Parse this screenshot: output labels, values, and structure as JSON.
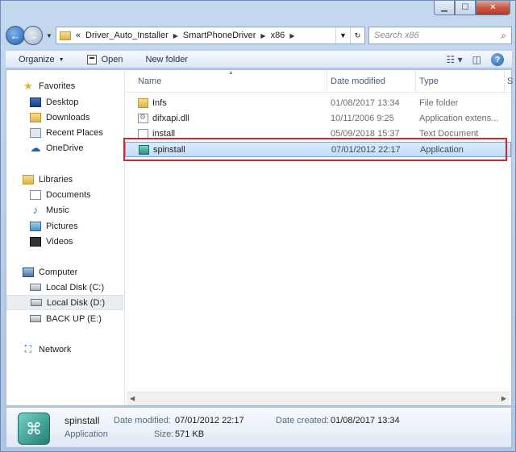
{
  "window": {
    "controls": {
      "minimize": "▁",
      "maximize": "☐",
      "close": "✕"
    }
  },
  "address": {
    "overflow": "«",
    "parts": [
      "Driver_Auto_Installer",
      "SmartPhoneDriver",
      "x86"
    ],
    "search_placeholder": "Search x86"
  },
  "toolbar": {
    "organize": "Organize",
    "open": "Open",
    "new_folder": "New folder"
  },
  "nav": {
    "favorites": "Favorites",
    "desktop": "Desktop",
    "downloads": "Downloads",
    "recent": "Recent Places",
    "onedrive": "OneDrive",
    "libraries": "Libraries",
    "documents": "Documents",
    "music": "Music",
    "pictures": "Pictures",
    "videos": "Videos",
    "computer": "Computer",
    "disk_c": "Local Disk (C:)",
    "disk_d": "Local Disk (D:)",
    "backup_e": "BACK UP (E:)",
    "network": "Network"
  },
  "columns": {
    "name": "Name",
    "date": "Date modified",
    "type": "Type",
    "size": "S"
  },
  "files": [
    {
      "name": "Infs",
      "date": "01/08/2017 13:34",
      "type": "File folder"
    },
    {
      "name": "difxapi.dll",
      "date": "10/11/2006 9:25",
      "type": "Application extens..."
    },
    {
      "name": "install",
      "date": "05/09/2018 15:37",
      "type": "Text Document"
    },
    {
      "name": "spinstall",
      "date": "07/01/2012 22:17",
      "type": "Application"
    }
  ],
  "details": {
    "name": "spinstall",
    "kind": "Application",
    "modified_label": "Date modified:",
    "modified_value": "07/01/2012 22:17",
    "created_label": "Date created:",
    "created_value": "01/08/2017 13:34",
    "size_label": "Size:",
    "size_value": "571 KB"
  },
  "colors": {
    "highlight_border": "#d8232a",
    "selection": "#c1dcfc"
  }
}
